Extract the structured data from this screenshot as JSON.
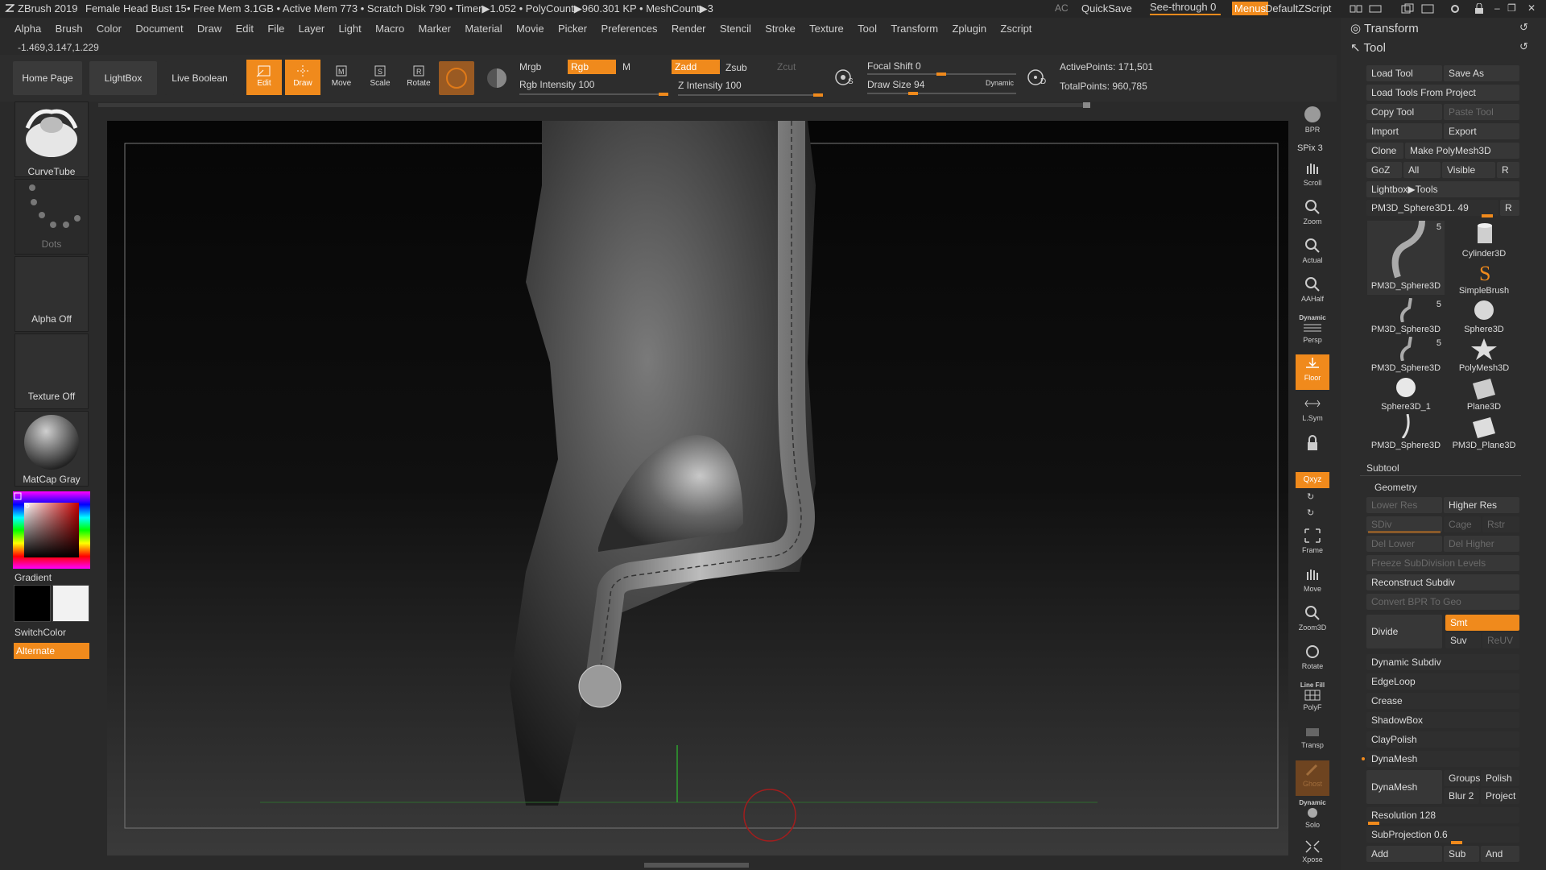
{
  "titlebar": {
    "app": "ZBrush 2019",
    "doc": "Female Head Bust 15",
    "stats": "• Free Mem 3.1GB • Active Mem 773 • Scratch Disk 790 •  Timer▶1.052 • PolyCount▶960.301 KP  • MeshCount▶3",
    "ac": "AC",
    "quicksave": "QuickSave",
    "seethrough": "See-through  0",
    "menus": "Menus",
    "script": "DefaultZScript"
  },
  "menubar": [
    "Alpha",
    "Brush",
    "Color",
    "Document",
    "Draw",
    "Edit",
    "File",
    "Layer",
    "Light",
    "Macro",
    "Marker",
    "Material",
    "Movie",
    "Picker",
    "Preferences",
    "Render",
    "Stencil",
    "Stroke",
    "Texture",
    "Tool",
    "Transform",
    "Zplugin",
    "Zscript"
  ],
  "coords": "-1.469,3.147,1.229",
  "toolbar": {
    "home": "Home Page",
    "lightbox": "LightBox",
    "liveboolean": "Live Boolean",
    "edit": "Edit",
    "draw": "Draw",
    "move": "Move",
    "scale": "Scale",
    "rotate": "Rotate",
    "mrgb": "Mrgb",
    "rgb": "Rgb",
    "m": "M",
    "rgb_intensity": "Rgb Intensity 100",
    "zadd": "Zadd",
    "zsub": "Zsub",
    "zcut": "Zcut",
    "z_intensity": "Z Intensity 100",
    "focal_shift": "Focal Shift 0",
    "draw_size": "Draw Size 94",
    "dynamic": "Dynamic",
    "active_points": "ActivePoints: 171,501",
    "total_points": "TotalPoints: 960,785",
    "s_label": "S",
    "d_label": "D"
  },
  "leftpanel": {
    "brush": "CurveTube",
    "stroke": "Dots",
    "alpha": "Alpha Off",
    "texture": "Texture Off",
    "material": "MatCap Gray",
    "gradient": "Gradient",
    "switchcolor": "SwitchColor",
    "alternate": "Alternate"
  },
  "rightdock": {
    "bpr": "BPR",
    "spix": "SPix 3",
    "scroll": "Scroll",
    "zoom": "Zoom",
    "actual": "Actual",
    "aahalf": "AAHalf",
    "dynamic_persp": "Dynamic",
    "persp": "Persp",
    "floor": "Floor",
    "lsym": "L.Sym",
    "xyz": "Qxyz",
    "frame": "Frame",
    "move": "Move",
    "zoom3d": "Zoom3D",
    "rotate": "Rotate",
    "linefill": "Line Fill",
    "polyf": "PolyF",
    "transp": "Transp",
    "ghost": "Ghost",
    "dynamic_solo": "Dynamic",
    "solo": "Solo",
    "xpose": "Xpose"
  },
  "rightpanel": {
    "transform": "Transform",
    "tool": "Tool",
    "load_tool": "Load Tool",
    "save_as": "Save As",
    "load_from_project": "Load Tools From Project",
    "copy_tool": "Copy Tool",
    "paste_tool": "Paste Tool",
    "import": "Import",
    "export": "Export",
    "clone": "Clone",
    "make_polymesh": "Make PolyMesh3D",
    "goz": "GoZ",
    "all": "All",
    "visible": "Visible",
    "r": "R",
    "lightbox_tools": "Lightbox▶Tools",
    "current_tool": "PM3D_Sphere3D1. 49",
    "thumbs": [
      {
        "label": "PM3D_Sphere3D",
        "count": "5"
      },
      {
        "label": "Cylinder3D",
        "count": ""
      },
      {
        "label": "",
        "count": ""
      },
      {
        "label": "SimpleBrush",
        "count": ""
      },
      {
        "label": "PM3D_Sphere3D",
        "count": "5"
      },
      {
        "label": "Sphere3D",
        "count": ""
      },
      {
        "label": "PM3D_Sphere3D",
        "count": "5"
      },
      {
        "label": "PolyMesh3D",
        "count": ""
      },
      {
        "label": "Sphere3D_1",
        "count": ""
      },
      {
        "label": "Plane3D",
        "count": ""
      },
      {
        "label": "PM3D_Sphere3D",
        "count": ""
      },
      {
        "label": "PM3D_Plane3D",
        "count": ""
      }
    ],
    "subtool": "Subtool",
    "geometry": "Geometry",
    "lower_res": "Lower Res",
    "higher_res": "Higher Res",
    "sdiv": "SDiv",
    "cage": "Cage",
    "rstr": "Rstr",
    "del_lower": "Del Lower",
    "del_higher": "Del Higher",
    "freeze": "Freeze SubDivision Levels",
    "reconstruct": "Reconstruct Subdiv",
    "convert_bpr": "Convert BPR To Geo",
    "divide": "Divide",
    "smt": "Smt",
    "suv": "Suv",
    "reuv": "ReUV",
    "dynamic_subdiv": "Dynamic Subdiv",
    "edgeloop": "EdgeLoop",
    "crease": "Crease",
    "shadowbox": "ShadowBox",
    "claypolish": "ClayPolish",
    "dynamesh_header": "DynaMesh",
    "dynamesh": "DynaMesh",
    "groups": "Groups",
    "polish": "Polish",
    "blur": "Blur 2",
    "project": "Project",
    "resolution": "Resolution 128",
    "subprojection": "SubProjection 0.6",
    "add": "Add",
    "sub": "Sub",
    "and": "And"
  },
  "colors": {
    "accent": "#f08a1c",
    "panel": "#2c2c2c",
    "canvas": "#111111"
  }
}
